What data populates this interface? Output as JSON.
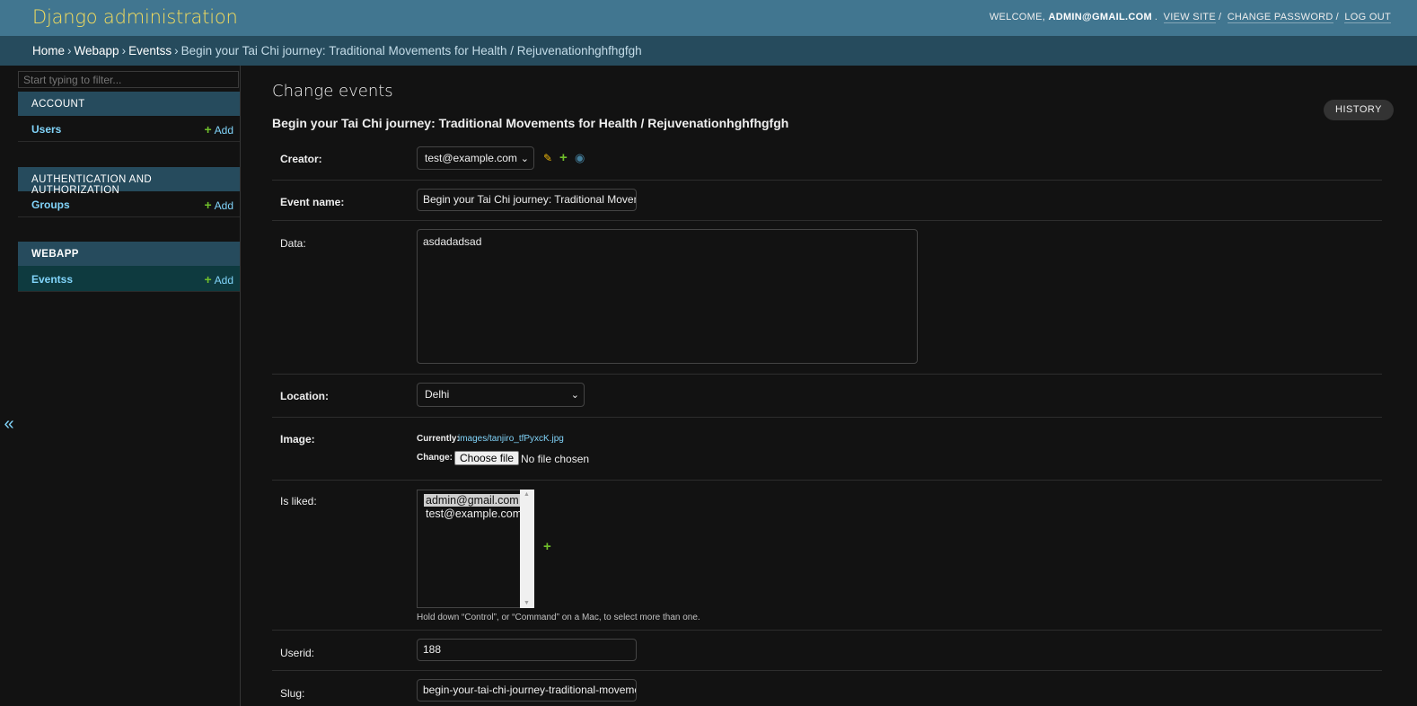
{
  "header": {
    "branding": "Django administration",
    "welcome": "WELCOME,",
    "username": "ADMIN@GMAIL.COM",
    "view_site": "VIEW SITE",
    "change_password": "CHANGE PASSWORD",
    "logout": "LOG OUT"
  },
  "breadcrumbs": {
    "home": "Home",
    "app": "Webapp",
    "model": "Eventss",
    "current": "Begin your Tai Chi journey: Traditional Movements for Health / Rejuvenationhghfhgfgh"
  },
  "sidebar": {
    "filter_placeholder": "Start typing to filter...",
    "modules": [
      {
        "caption": "ACCOUNT",
        "model": "Users",
        "add": "Add"
      },
      {
        "caption": "AUTHENTICATION AND AUTHORIZATION",
        "model": "Groups",
        "add": "Add"
      },
      {
        "caption": "WEBAPP",
        "model": "Eventss",
        "add": "Add"
      }
    ],
    "toggle_icon": "«"
  },
  "content": {
    "title": "Change events",
    "subtitle": "Begin your Tai Chi journey: Traditional Movements for Health / Rejuvenationhghfhgfgh",
    "history": "HISTORY"
  },
  "form": {
    "creator": {
      "label": "Creator:",
      "value": "test@example.com"
    },
    "event_name": {
      "label": "Event name:",
      "value": "Begin your Tai Chi journey: Traditional Movem"
    },
    "data": {
      "label": "Data:",
      "value": "asdadadsad"
    },
    "location": {
      "label": "Location:",
      "value": "Delhi"
    },
    "image": {
      "label": "Image:",
      "currently_label": "Currently:",
      "currently_link": "images/tanjiro_tfPyxcK.jpg",
      "change_label": "Change:",
      "choose_file": "Choose file",
      "no_file": "No file chosen"
    },
    "is_liked": {
      "label": "Is liked:",
      "options": [
        "admin@gmail.com",
        "test@example.com"
      ],
      "help": "Hold down “Control”, or “Command” on a Mac, to select more than one."
    },
    "userid": {
      "label": "Userid:",
      "value": "188"
    },
    "slug": {
      "label": "Slug:",
      "value": "begin-your-tai-chi-journey-traditional-moveme"
    }
  },
  "colors": {
    "header_bg": "#417690",
    "breadcrumbs_bg": "#264b5d",
    "branding": "#f5dd5d",
    "link": "#81d4fa",
    "add_plus": "#70bf2b",
    "page_bg": "#121212"
  },
  "icons": {
    "change_related": "pencil-icon",
    "add_related": "plus-icon",
    "view_related": "eye-icon"
  }
}
